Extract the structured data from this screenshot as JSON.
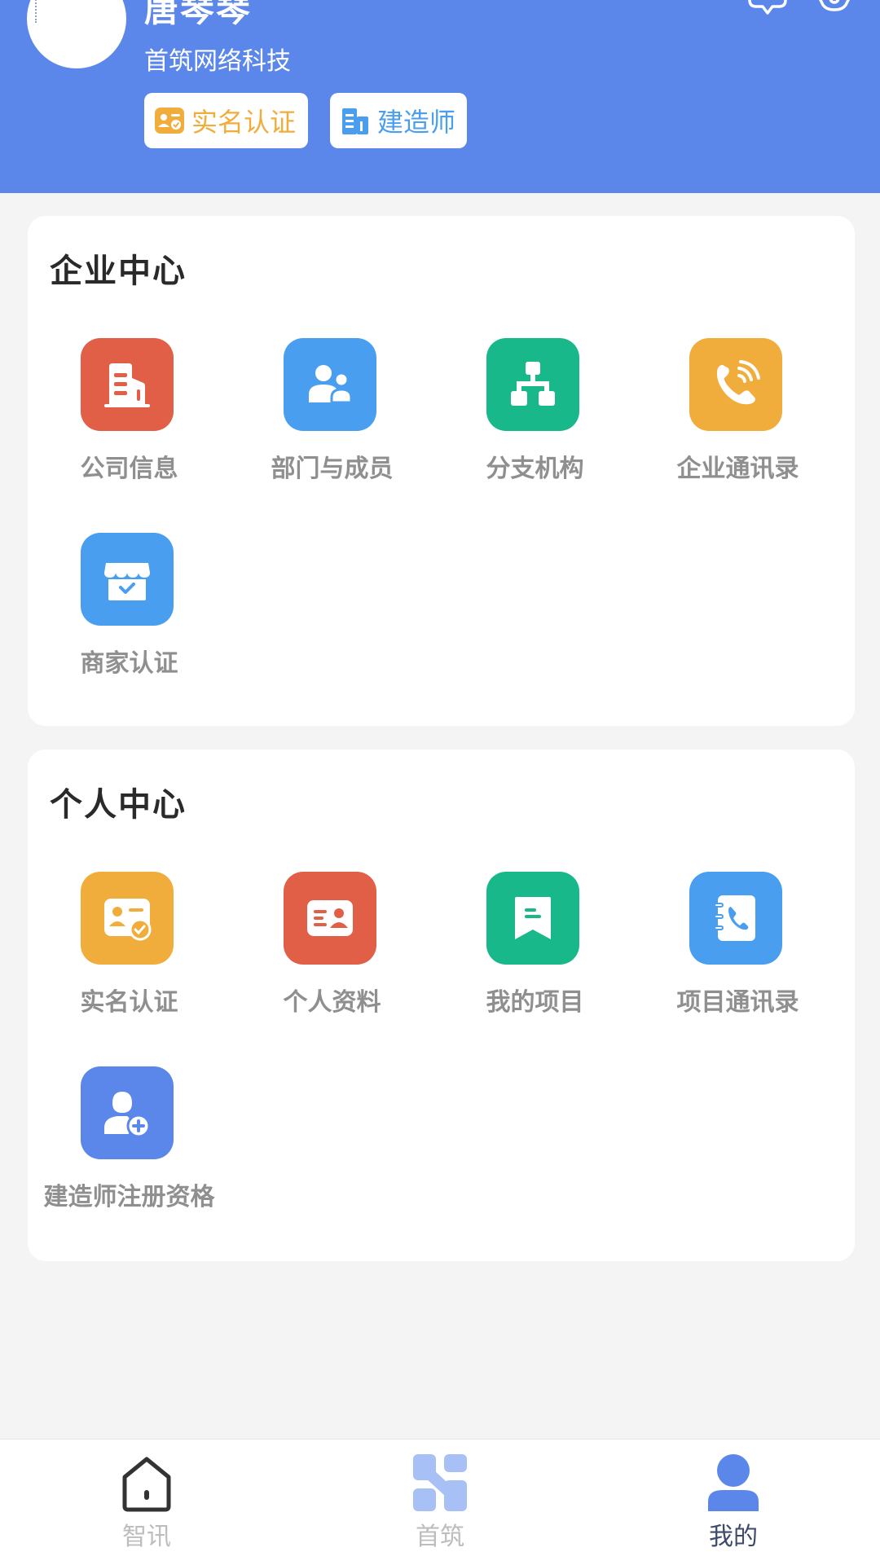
{
  "profile": {
    "name": "唐琴琴",
    "company": "首筑网络科技",
    "tags": {
      "realname": "实名认证",
      "builder": "建造师"
    }
  },
  "enterprise_center": {
    "title": "企业中心",
    "items": [
      {
        "label": "公司信息",
        "icon": "building-icon",
        "color": "#e15f47"
      },
      {
        "label": "部门与成员",
        "icon": "members-icon",
        "color": "#4a9ef0"
      },
      {
        "label": "分支机构",
        "icon": "org-tree-icon",
        "color": "#19b88a"
      },
      {
        "label": "企业通讯录",
        "icon": "phone-call-icon",
        "color": "#f0ad3c"
      },
      {
        "label": "商家认证",
        "icon": "store-verify-icon",
        "color": "#4a9ef0"
      }
    ]
  },
  "personal_center": {
    "title": "个人中心",
    "items": [
      {
        "label": "实名认证",
        "icon": "id-verify-icon",
        "color": "#f0ad3c"
      },
      {
        "label": "个人资料",
        "icon": "profile-card-icon",
        "color": "#e15f47"
      },
      {
        "label": "我的项目",
        "icon": "bookmark-icon",
        "color": "#19b88a"
      },
      {
        "label": "项目通讯录",
        "icon": "contact-book-icon",
        "color": "#4a9ef0"
      },
      {
        "label": "建造师注册资格",
        "icon": "add-user-icon",
        "color": "#5b86ea"
      }
    ]
  },
  "bottom_nav": {
    "items": [
      {
        "label": "智讯",
        "icon": "home-outline-icon",
        "active": false
      },
      {
        "label": "首筑",
        "icon": "app-logo-icon",
        "active": false
      },
      {
        "label": "我的",
        "icon": "person-icon",
        "active": true
      }
    ]
  },
  "colors": {
    "header_bg": "#5b86ea",
    "page_bg": "#f4f4f4",
    "label_gray": "#8f8f8f",
    "nav_inactive": "#bdbdbd",
    "nav_active": "#3d4a6b"
  }
}
